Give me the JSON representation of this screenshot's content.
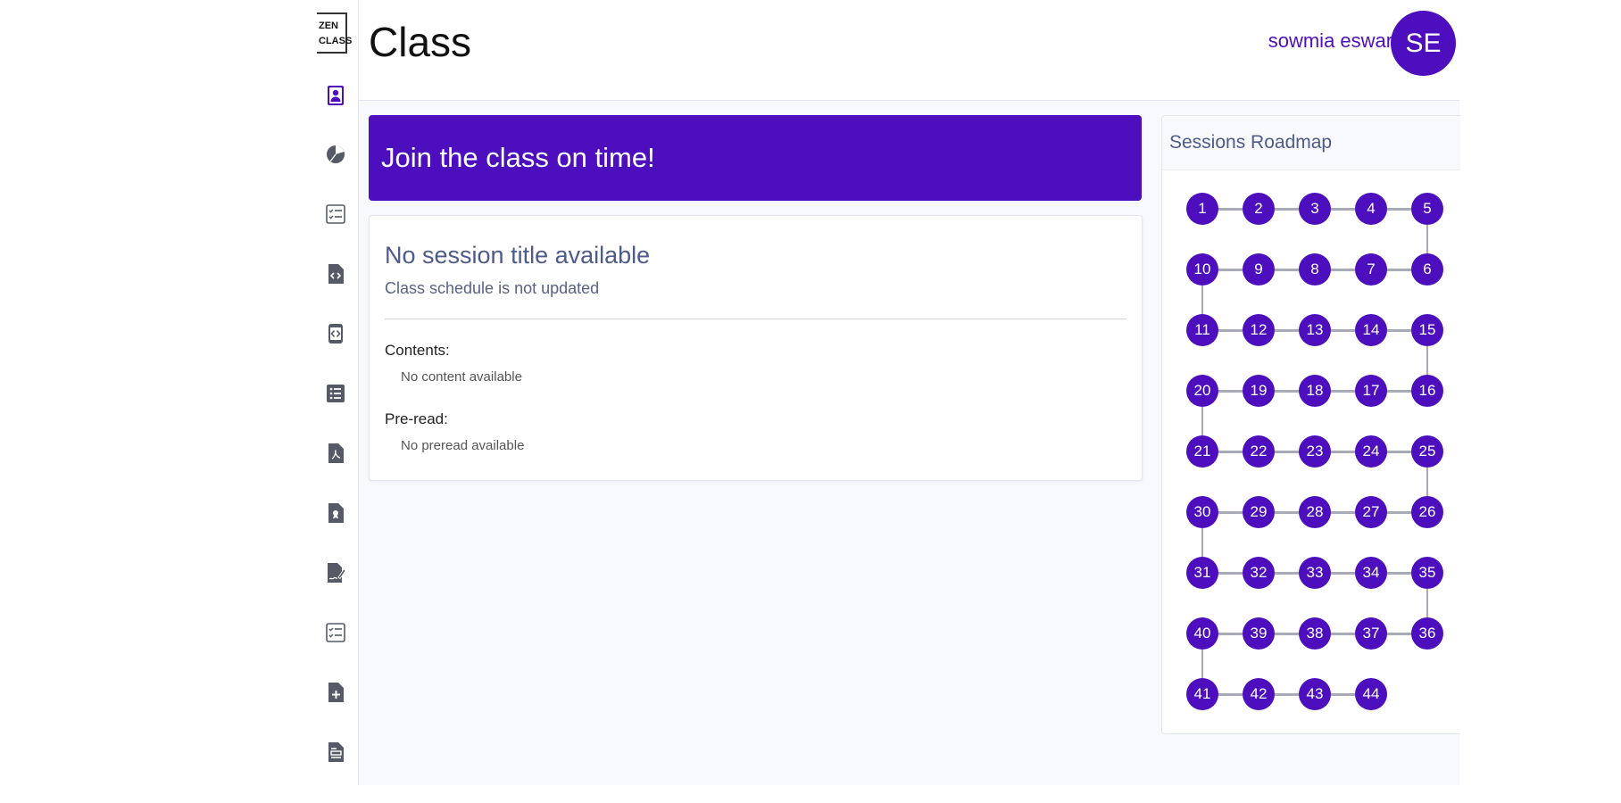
{
  "app": {
    "logo_line1": "ZEN",
    "logo_line2": "CLASS"
  },
  "sidebar": {
    "icons": [
      "user-profile-icon",
      "pie-chart-icon",
      "checklist-icon",
      "code-file-icon",
      "code-brackets-icon",
      "list-icon",
      "pdf-file-icon",
      "certificate-icon",
      "signature-icon",
      "checklist-icon",
      "file-plus-icon",
      "document-icon"
    ]
  },
  "header": {
    "title": "Class",
    "user_name": "sowmia eswari",
    "avatar_initials": "SE"
  },
  "banner": {
    "text": "Join the class on time!"
  },
  "session": {
    "title": "No session title available",
    "subtitle": "Class schedule is not updated",
    "contents_label": "Contents:",
    "contents_value": "No content available",
    "preread_label": "Pre-read:",
    "preread_value": "No preread available"
  },
  "roadmap": {
    "title": "Sessions Roadmap",
    "session_count": 44,
    "per_row": 5
  },
  "colors": {
    "accent": "#4d0fbd",
    "connector": "#a8abb5",
    "muted_text": "#4e5a8a"
  }
}
